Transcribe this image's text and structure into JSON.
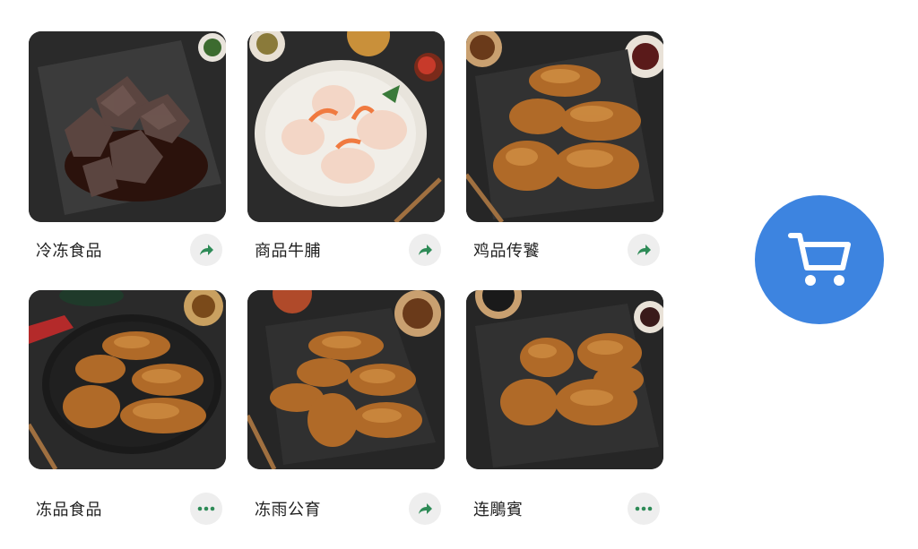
{
  "colors": {
    "accent_cart": "#3d84e0",
    "action_icon": "#2e8b57",
    "action_bg": "#eeeeee"
  },
  "products": [
    {
      "name": "冷冻食品",
      "image": "dark-dumplings-in-sauce",
      "action_icon": "share-arrow-icon"
    },
    {
      "name": "商品牛脯",
      "image": "shrimp-dumplings-plate",
      "action_icon": "share-arrow-icon"
    },
    {
      "name": "鸡品传饕",
      "image": "glazed-chicken-wings",
      "action_icon": "share-arrow-icon"
    },
    {
      "name": "冻品食品",
      "image": "glazed-chicken-wings-round-plate",
      "action_icon": "more-dots-icon"
    },
    {
      "name": "冻雨公育",
      "image": "glazed-chicken-wings-square-plate",
      "action_icon": "share-arrow-icon"
    },
    {
      "name": "连鵰賓",
      "image": "glazed-chicken-wings-dark-plate",
      "action_icon": "more-dots-icon"
    }
  ],
  "cart_button": {
    "icon": "shopping-cart-icon"
  }
}
